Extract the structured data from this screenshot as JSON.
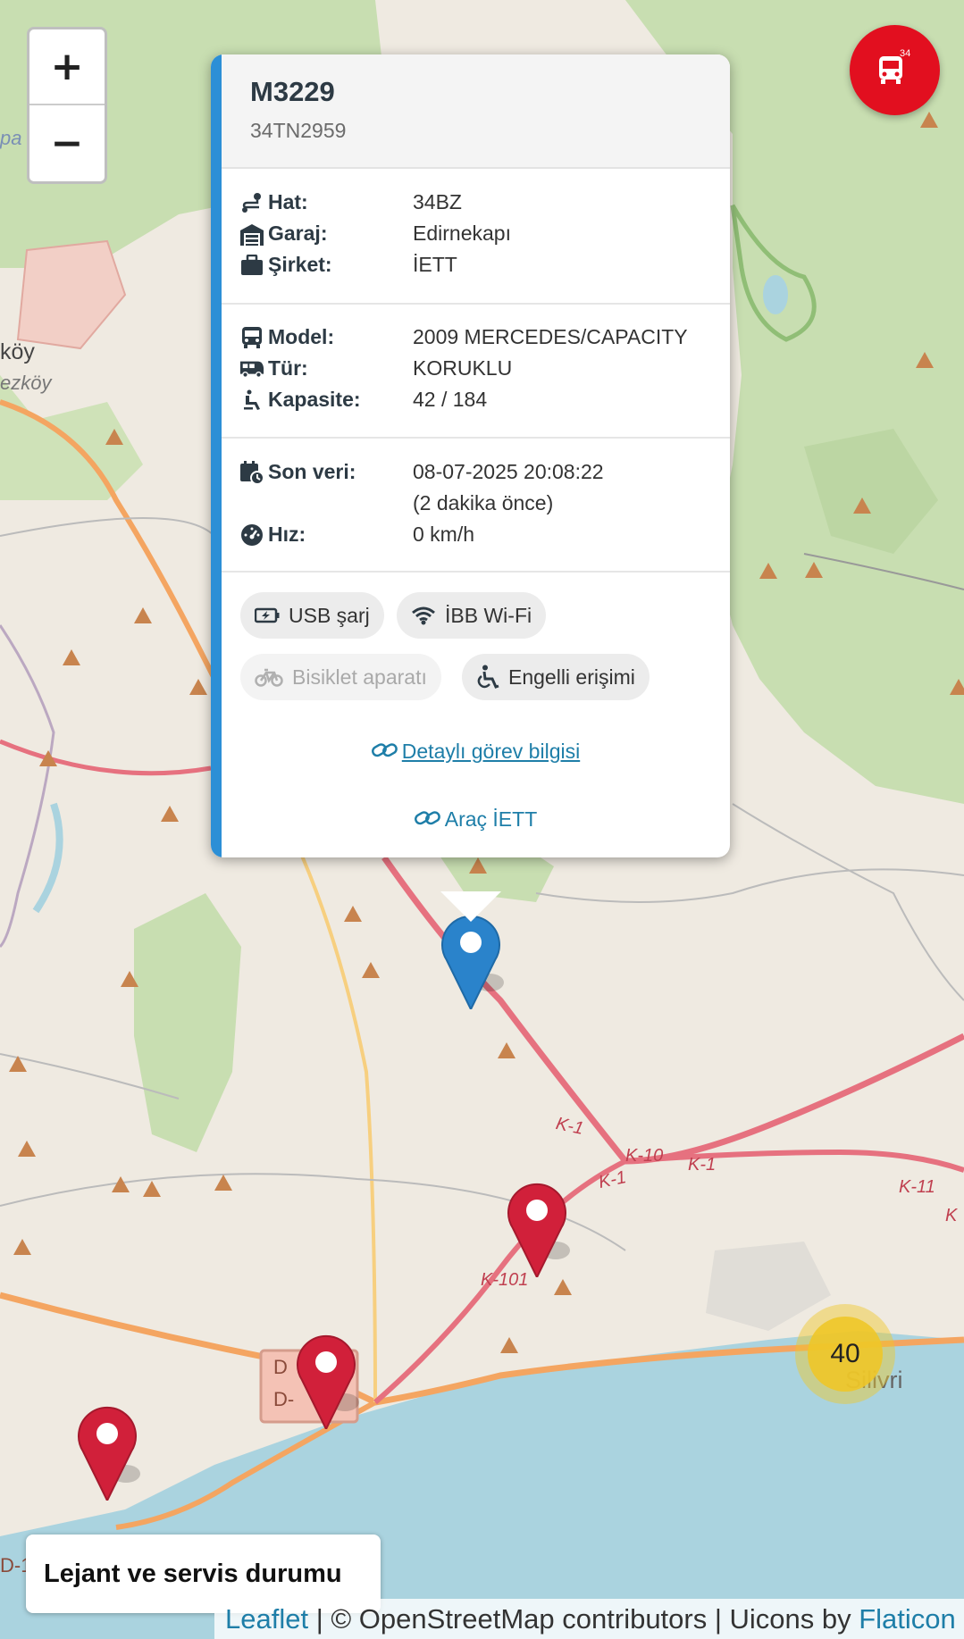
{
  "map": {
    "zoom_in_label": "+",
    "zoom_out_label": "−",
    "place_labels": [
      "köy",
      "ezköy",
      "Silivri",
      "pa"
    ],
    "road_labels": [
      "K-1",
      "K-10",
      "K-1",
      "K-1",
      "K-101",
      "K-11",
      "D",
      "D-",
      "D-1",
      "K"
    ]
  },
  "fab": {
    "icon": "bus-icon",
    "badge": "34",
    "color": "#e20f1f"
  },
  "popup": {
    "title": "M3229",
    "plate": "34TN2959",
    "accent_color": "#2c8fd6",
    "group1": [
      {
        "icon": "route-icon",
        "label": "Hat:",
        "value": "34BZ"
      },
      {
        "icon": "garage-icon",
        "label": "Garaj:",
        "value": "Edirnekapı"
      },
      {
        "icon": "briefcase-icon",
        "label": "Şirket:",
        "value": "İETT"
      }
    ],
    "group2": [
      {
        "icon": "bus-icon",
        "label": "Model:",
        "value": "2009 MERCEDES/CAPACITY"
      },
      {
        "icon": "van-icon",
        "label": "Tür:",
        "value": "KORUKLU"
      },
      {
        "icon": "seat-icon",
        "label": "Kapasite:",
        "value": "42 / 184"
      }
    ],
    "group3": {
      "last_data_label": "Son veri:",
      "last_data_value": "08-07-2025 20:08:22",
      "last_data_relative": "(2 dakika önce)",
      "speed_label": "Hız:",
      "speed_value": "0 km/h"
    },
    "features": [
      {
        "icon": "battery-charge-icon",
        "label": "USB şarj",
        "enabled": true
      },
      {
        "icon": "wifi-icon",
        "label": "İBB Wi-Fi",
        "enabled": true
      },
      {
        "icon": "bicycle-icon",
        "label": "Bisiklet aparatı",
        "enabled": false
      },
      {
        "icon": "wheelchair-icon",
        "label": "Engelli erişimi",
        "enabled": true
      }
    ],
    "link_detail": "Detaylı görev bilgisi",
    "link_vehicle": "Araç İETT"
  },
  "cluster": {
    "count": "40"
  },
  "legend": {
    "label": "Lejant ve servis durumu"
  },
  "attribution": {
    "leaflet": "Leaflet",
    "osm": " | © OpenStreetMap contributors | Uicons by ",
    "flaticon": "Flaticon"
  }
}
